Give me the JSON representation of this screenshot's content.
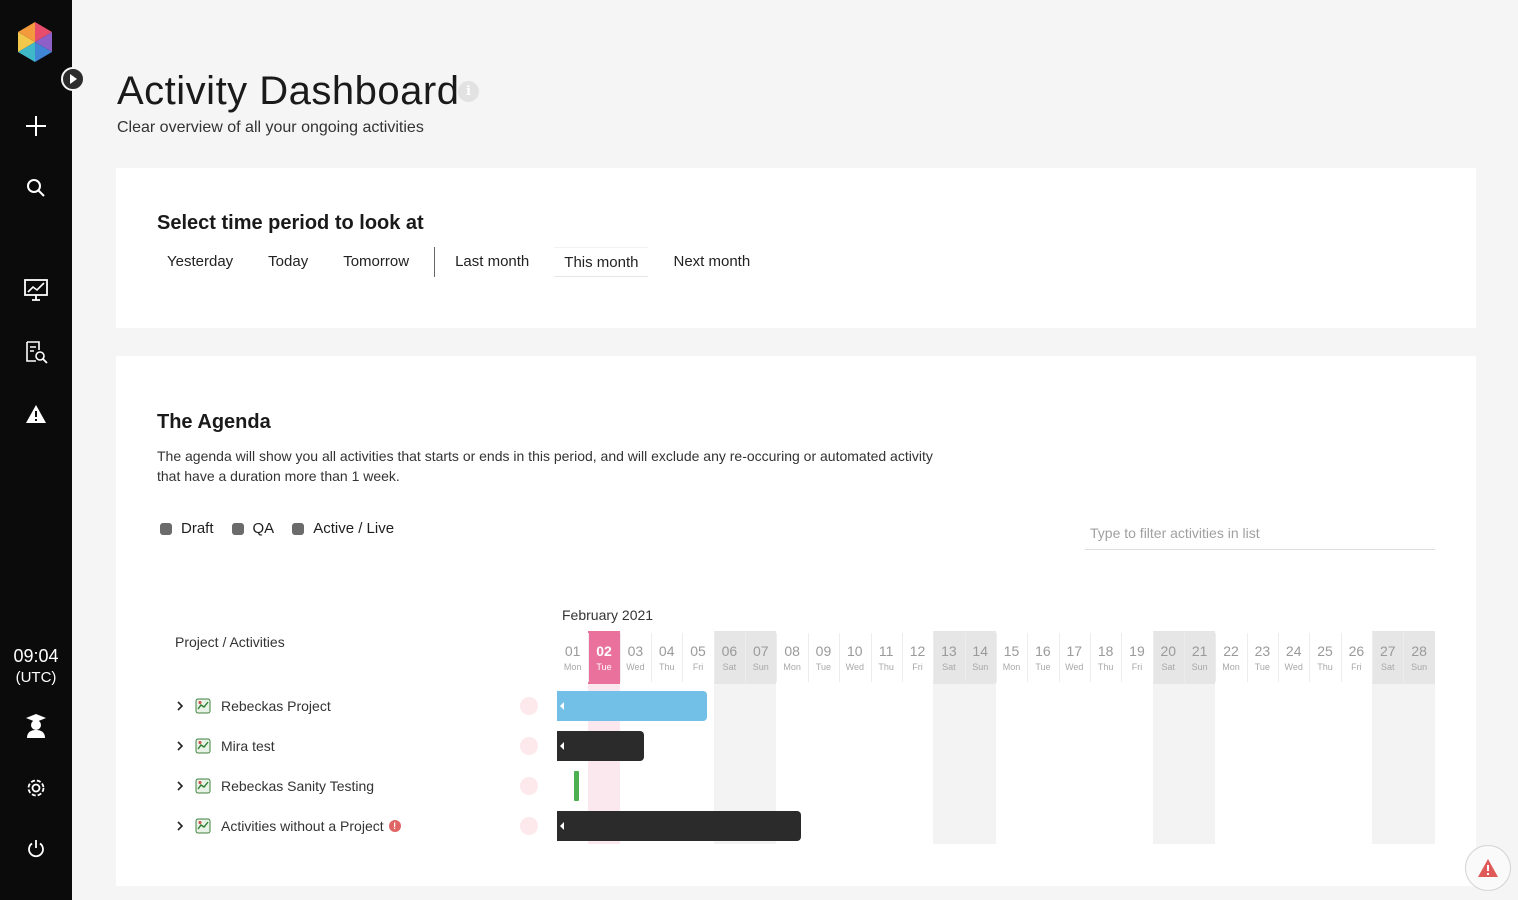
{
  "sidebar": {
    "clock_time": "09:04",
    "clock_zone": "(UTC)"
  },
  "header": {
    "title": "Activity Dashboard",
    "subtitle": "Clear overview of all your ongoing activities"
  },
  "period": {
    "heading": "Select time period to look at",
    "options": [
      "Yesterday",
      "Today",
      "Tomorrow",
      "Last month",
      "This month",
      "Next month"
    ],
    "selected": "This month"
  },
  "agenda": {
    "heading": "The Agenda",
    "description": "The agenda will show you all activities that starts or ends in this period, and will exclude any re-occuring or automated activity that have a duration more than 1 week.",
    "legend": [
      "Draft",
      "QA",
      "Active / Live"
    ],
    "filter_placeholder": "Type to filter activities in list",
    "month_label": "February 2021",
    "column_header": "Project / Activities",
    "days": [
      {
        "n": "01",
        "w": "Mon"
      },
      {
        "n": "02",
        "w": "Tue"
      },
      {
        "n": "03",
        "w": "Wed"
      },
      {
        "n": "04",
        "w": "Thu"
      },
      {
        "n": "05",
        "w": "Fri"
      },
      {
        "n": "06",
        "w": "Sat"
      },
      {
        "n": "07",
        "w": "Sun"
      },
      {
        "n": "08",
        "w": "Mon"
      },
      {
        "n": "09",
        "w": "Tue"
      },
      {
        "n": "10",
        "w": "Wed"
      },
      {
        "n": "11",
        "w": "Thu"
      },
      {
        "n": "12",
        "w": "Fri"
      },
      {
        "n": "13",
        "w": "Sat"
      },
      {
        "n": "14",
        "w": "Sun"
      },
      {
        "n": "15",
        "w": "Mon"
      },
      {
        "n": "16",
        "w": "Tue"
      },
      {
        "n": "17",
        "w": "Wed"
      },
      {
        "n": "18",
        "w": "Thu"
      },
      {
        "n": "19",
        "w": "Fri"
      },
      {
        "n": "20",
        "w": "Sat"
      },
      {
        "n": "21",
        "w": "Sun"
      },
      {
        "n": "22",
        "w": "Mon"
      },
      {
        "n": "23",
        "w": "Tue"
      },
      {
        "n": "24",
        "w": "Wed"
      },
      {
        "n": "25",
        "w": "Thu"
      },
      {
        "n": "26",
        "w": "Fri"
      },
      {
        "n": "27",
        "w": "Sat"
      },
      {
        "n": "28",
        "w": "Sun"
      }
    ],
    "today_index": 1,
    "projects": [
      {
        "name": "Rebeckas Project",
        "warning": false,
        "bar_color": "blue",
        "bar_start_day": 1,
        "bar_end_day": 5
      },
      {
        "name": "Mira test",
        "warning": false,
        "bar_color": "dark",
        "bar_start_day": 1,
        "bar_end_day": 3
      },
      {
        "name": "Rebeckas Sanity Testing",
        "warning": false,
        "bar_color": "green",
        "bar_start_day": 1.6,
        "bar_end_day": 1.8
      },
      {
        "name": "Activities without a Project",
        "warning": true,
        "warning_text": "!",
        "bar_color": "dark",
        "bar_start_day": 1,
        "bar_end_day": 8
      }
    ]
  },
  "colors": {
    "accent_pink": "#e9719c",
    "bar_blue": "#72bfe8",
    "bar_dark": "#2b2b2b",
    "bar_green": "#4caf50",
    "sidebar_bg": "#0b0b0b"
  }
}
